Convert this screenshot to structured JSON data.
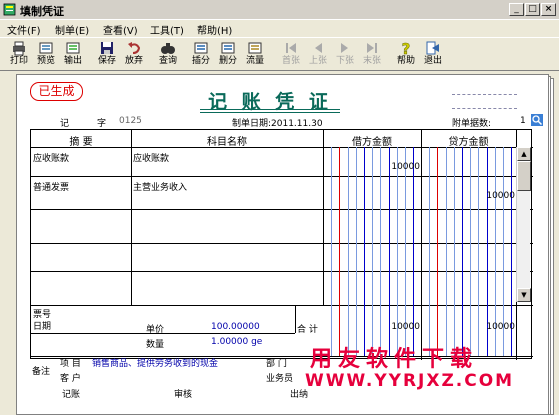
{
  "window": {
    "title": "填制凭证",
    "min": "_",
    "max": "□",
    "close": "×"
  },
  "menu": [
    "文件(F)",
    "制单(E)",
    "查看(V)",
    "工具(T)",
    "帮助(H)"
  ],
  "toolbar": [
    {
      "label": "打印",
      "icon": "printer-icon",
      "enabled": true
    },
    {
      "label": "预览",
      "icon": "preview-icon",
      "enabled": true
    },
    {
      "label": "输出",
      "icon": "export-icon",
      "enabled": true
    },
    {
      "label": "保存",
      "icon": "save-icon",
      "enabled": true
    },
    {
      "label": "放弃",
      "icon": "undo-icon",
      "enabled": true
    },
    {
      "label": "查询",
      "icon": "binoculars-icon",
      "enabled": true
    },
    {
      "label": "插分",
      "icon": "insert-row-icon",
      "enabled": true
    },
    {
      "label": "删分",
      "icon": "delete-row-icon",
      "enabled": true
    },
    {
      "label": "流量",
      "icon": "flow-icon",
      "enabled": true
    },
    {
      "label": "首张",
      "icon": "first-icon",
      "enabled": false
    },
    {
      "label": "上张",
      "icon": "prev-icon",
      "enabled": false
    },
    {
      "label": "下张",
      "icon": "next-icon",
      "enabled": false
    },
    {
      "label": "末张",
      "icon": "last-icon",
      "enabled": false
    },
    {
      "label": "帮助",
      "icon": "help-icon",
      "enabled": true
    },
    {
      "label": "退出",
      "icon": "exit-icon",
      "enabled": true
    }
  ],
  "voucher": {
    "stamp": "已生成",
    "title": "记 账 凭 证",
    "type_label": "记",
    "zi_label": "字",
    "number": "0125",
    "date": "制单日期:2011.11.30",
    "attach_label": "附单据数:",
    "attach_count": "1",
    "headers": {
      "summary": "摘 要",
      "account": "科目名称",
      "debit": "借方金额",
      "credit": "贷方金额"
    },
    "rows": [
      {
        "summary": "应收账款",
        "account": "应收账款",
        "debit": "10000",
        "credit": ""
      },
      {
        "summary": "普通发票",
        "account": "主营业务收入",
        "debit": "",
        "credit": "10000"
      },
      {
        "summary": "",
        "account": "",
        "debit": "",
        "credit": ""
      },
      {
        "summary": "",
        "account": "",
        "debit": "",
        "credit": ""
      },
      {
        "summary": "",
        "account": "",
        "debit": "",
        "credit": ""
      }
    ],
    "ticket_no_label": "票号",
    "date_label": "日期",
    "price_label": "单价",
    "price_value": "100.00000",
    "qty_label": "数量",
    "qty_value": "1.00000 ge",
    "total_label": "合 计",
    "total_debit": "10000",
    "total_credit": "10000",
    "remark_label": "备注",
    "project_label": "项  目",
    "project_value": "销售商品、提供劳务收到的现金",
    "customer_label": "客  户",
    "dept_label": "部  门",
    "salesman_label": "业务员",
    "bookkeeper_label": "记账",
    "review_label": "审核",
    "cashier_label": "出纳"
  },
  "watermark": {
    "cn": "用友软件下载",
    "url": "WWW.YYRJXZ.COM"
  }
}
